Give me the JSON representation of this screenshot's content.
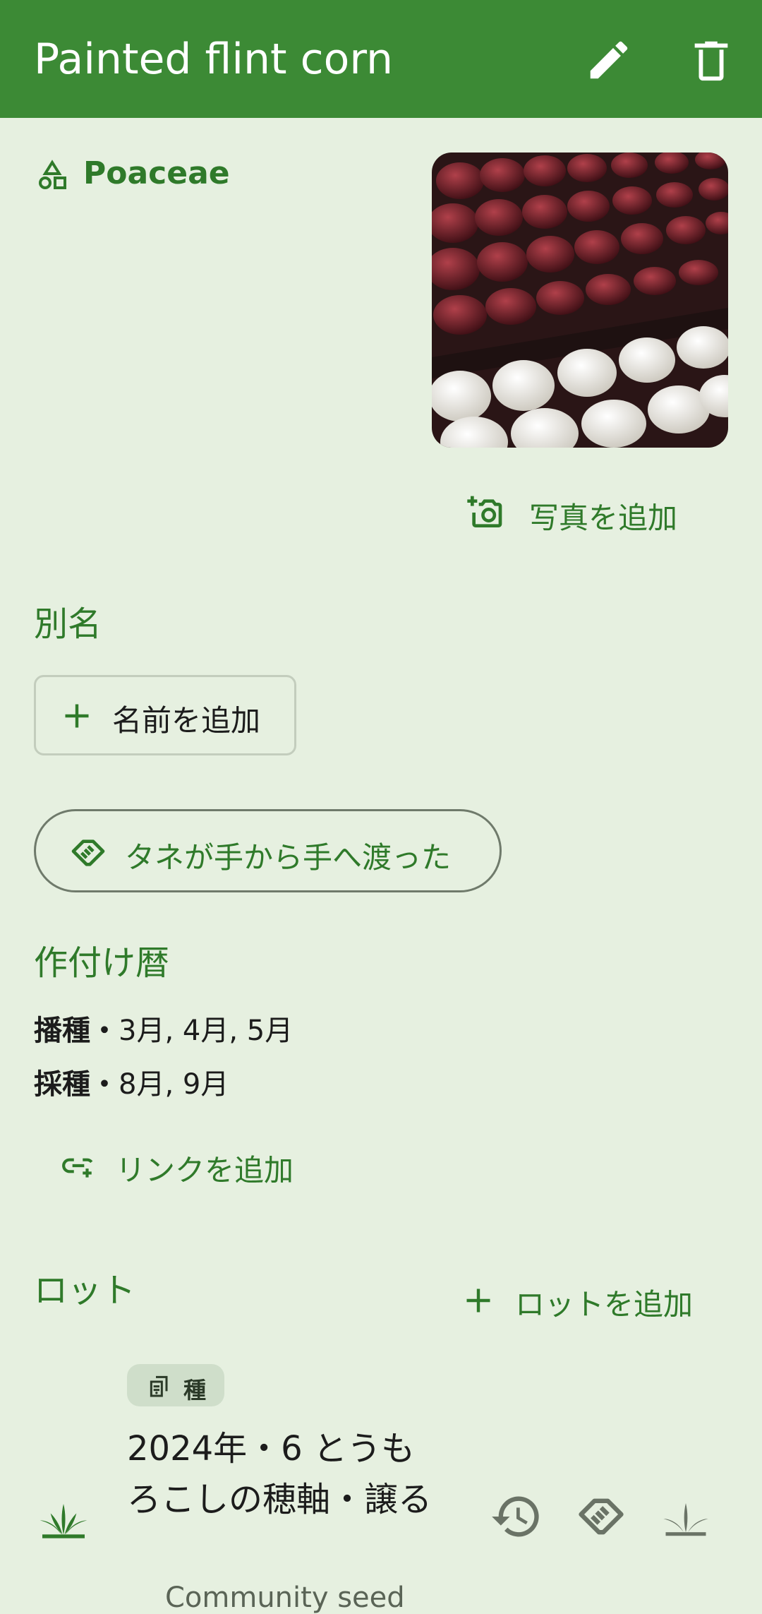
{
  "app_bar": {
    "title": "Painted flint corn",
    "background": "#3c8a35",
    "actions": [
      {
        "label": "edit",
        "icon": "pencil-icon"
      },
      {
        "label": "delete",
        "icon": "trash-icon"
      }
    ]
  },
  "variety": {
    "family": "Poaceae",
    "family_icon": "shapes-icon",
    "photo_alt": "red and white corn kernels",
    "add_photo_label": "写真を追加"
  },
  "aliases": {
    "title": "別名",
    "add_name_label": "名前を追加"
  },
  "handed_down": {
    "label": "タネが手から手へ渡った",
    "icon": "handshake-icon"
  },
  "calendar": {
    "title": "作付け暦",
    "rows": [
      {
        "key": "播種",
        "sep": "・",
        "value": "3月, 4月, 5月"
      },
      {
        "key": "採種",
        "sep": "・",
        "value": "8月, 9月"
      }
    ]
  },
  "links": {
    "add_link_label": "リンクを追加"
  },
  "lots": {
    "title": "ロット",
    "add_lot_label": "ロットを追加",
    "items": [
      {
        "badge": "種",
        "name": "2024年・6 とうもろこしの穂軸・譲る",
        "source": "Community seed"
      }
    ]
  },
  "colors": {
    "accent": "#2f7a2a",
    "background": "#e6f0e0",
    "badge": "#cfdeca"
  }
}
